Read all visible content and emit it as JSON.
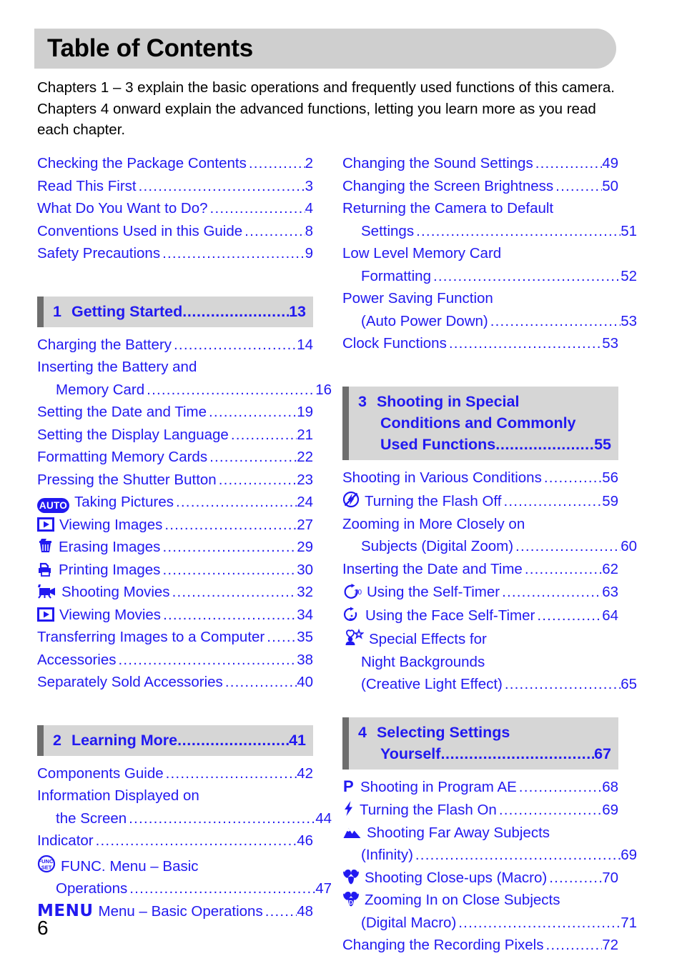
{
  "page": {
    "title": "Table of Contents",
    "folio": "6",
    "intro": "Chapters 1 – 3 explain the basic operations and frequently used functions of this camera. Chapters 4 onward explain the advanced functions, letting you learn more as you read each chapter.",
    "accent_color": "#2119f0",
    "title_bar_color": "#cfcfcf",
    "chapter_bar_color": "#d6d6d6",
    "chapter_tab_color": "#6e6e6e"
  },
  "left_column": {
    "front_matter": [
      {
        "text": "Checking the Package Contents",
        "page": "2"
      },
      {
        "text": "Read This First",
        "page": "3"
      },
      {
        "text": "What Do You Want to Do?",
        "page": "4"
      },
      {
        "text": "Conventions Used in this Guide",
        "page": "8"
      },
      {
        "text": "Safety Precautions",
        "page": "9"
      }
    ],
    "chapter1": {
      "number": "1",
      "title": "Getting Started",
      "page": "13",
      "entries": [
        {
          "text": "Charging the Battery",
          "page": "14"
        },
        {
          "text": "Inserting the Battery and",
          "text2": "Memory Card",
          "page": "16"
        },
        {
          "text": "Setting the Date and Time",
          "page": "19"
        },
        {
          "text": "Setting the Display Language",
          "page": "21"
        },
        {
          "text": "Formatting Memory Cards",
          "page": "22"
        },
        {
          "text": "Pressing the Shutter Button",
          "page": "23"
        },
        {
          "icon": "auto-mode-icon",
          "text": "Taking Pictures",
          "page": "24"
        },
        {
          "icon": "playback-icon",
          "text": "Viewing Images",
          "page": "27"
        },
        {
          "icon": "erase-icon",
          "text": "Erasing Images",
          "page": "29"
        },
        {
          "icon": "print-icon",
          "text": "Printing Images",
          "page": "30"
        },
        {
          "icon": "movie-icon",
          "text": "Shooting Movies",
          "page": "32"
        },
        {
          "icon": "playback-icon",
          "text": "Viewing Movies",
          "page": "34"
        },
        {
          "text": "Transferring Images to a Computer",
          "page": "35"
        },
        {
          "text": "Accessories",
          "page": "38"
        },
        {
          "text": "Separately Sold Accessories",
          "page": "40"
        }
      ]
    },
    "chapter2": {
      "number": "2",
      "title": "Learning More",
      "page": "41",
      "entries": [
        {
          "text": "Components Guide",
          "page": "42"
        },
        {
          "text": "Information Displayed on",
          "text2": "the Screen",
          "page": "44"
        },
        {
          "text": "Indicator",
          "page": "46"
        },
        {
          "icon": "func-set-icon",
          "text": "FUNC. Menu – Basic",
          "text2": "Operations",
          "page": "47"
        },
        {
          "icon": "menu-icon",
          "text": "Menu – Basic Operations",
          "page": "48"
        }
      ]
    }
  },
  "right_column": {
    "chapter2_continued": [
      {
        "text": "Changing the Sound Settings",
        "page": "49"
      },
      {
        "text": "Changing the Screen Brightness",
        "page": "50"
      },
      {
        "text": "Returning the Camera to Default",
        "text2": "Settings",
        "page": "51"
      },
      {
        "text": "Low Level Memory Card",
        "text2": "Formatting",
        "page": "52"
      },
      {
        "text": "Power Saving Function",
        "text2": "(Auto Power Down)",
        "page": "53"
      },
      {
        "text": "Clock Functions",
        "page": "53"
      }
    ],
    "chapter3": {
      "number": "3",
      "title": "Shooting in Special",
      "title2": "Conditions and Commonly",
      "title3": "Used Functions",
      "page": "55",
      "entries": [
        {
          "text": "Shooting in Various Conditions",
          "page": "56"
        },
        {
          "icon": "flash-off-icon",
          "text": "Turning the Flash Off",
          "page": "59"
        },
        {
          "text": "Zooming in More Closely on",
          "text2": "Subjects (Digital Zoom)",
          "page": "60"
        },
        {
          "text": "Inserting the Date and Time",
          "page": "62"
        },
        {
          "icon": "self-timer-icon",
          "text": "Using the Self-Timer",
          "page": "63"
        },
        {
          "icon": "face-self-timer-icon",
          "text": "Using the Face Self-Timer",
          "page": "64"
        },
        {
          "icon": "creative-light-icon",
          "text": "Special Effects for",
          "text2": "Night Backgrounds",
          "text3": "(Creative Light Effect)",
          "page": "65"
        }
      ]
    },
    "chapter4": {
      "number": "4",
      "title": "Selecting Settings",
      "title2": "Yourself",
      "page": "67",
      "entries": [
        {
          "icon": "program-ae-icon",
          "text": "Shooting in Program AE",
          "page": "68"
        },
        {
          "icon": "flash-on-icon",
          "text": "Turning the Flash On",
          "page": "69"
        },
        {
          "icon": "infinity-icon",
          "text": "Shooting Far Away Subjects",
          "text2": "(Infinity)",
          "page": "69"
        },
        {
          "icon": "macro-icon",
          "text": "Shooting Close-ups (Macro)",
          "page": "70"
        },
        {
          "icon": "digital-macro-icon",
          "text": "Zooming In on Close Subjects",
          "text2": "(Digital Macro)",
          "page": "71"
        },
        {
          "text": "Changing the Recording Pixels",
          "page": "72"
        }
      ]
    }
  }
}
